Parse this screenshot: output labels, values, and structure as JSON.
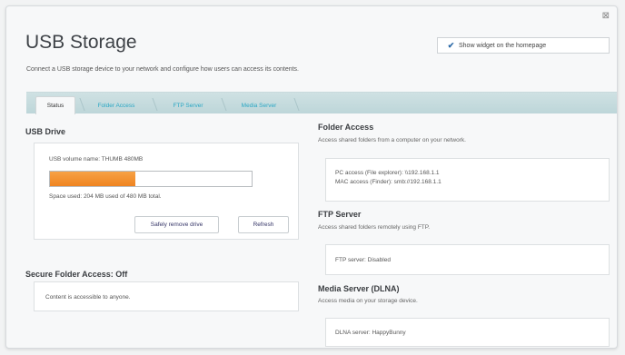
{
  "page": {
    "title": "USB Storage",
    "subtitle": "Connect a USB storage device to your network and configure how users can access its contents.",
    "show_widget_label": "Show widget on the homepage",
    "show_widget_checked": true
  },
  "tabs": [
    {
      "label": "Status",
      "active": true
    },
    {
      "label": "Folder Access",
      "active": false
    },
    {
      "label": "FTP Server",
      "active": false
    },
    {
      "label": "Media Server",
      "active": false
    }
  ],
  "usb_drive": {
    "heading": "USB Drive",
    "volume_name": "USB volume name: THUMB 480MB",
    "space_used_text": "Space used: 204 MB used of 480 MB total.",
    "used_fraction": 0.425,
    "safely_remove_label": "Safely remove drive",
    "refresh_label": "Refresh"
  },
  "secure_folder": {
    "heading": "Secure Folder Access: Off",
    "text": "Content is accessible to anyone."
  },
  "folder_access": {
    "heading": "Folder Access",
    "desc": "Access shared folders from a computer on your network.",
    "pc_access": "PC access (File explorer): \\\\192.168.1.1",
    "mac_access": "MAC access (Finder): smb://192.168.1.1"
  },
  "ftp_server": {
    "heading": "FTP Server",
    "desc": "Access shared folders remotely using FTP.",
    "status": "FTP server: Disabled"
  },
  "media_server": {
    "heading": "Media Server (DLNA)",
    "desc": "Access media on your storage device.",
    "status": "DLNA server: HappyBunny"
  },
  "colors": {
    "progress": "#ef8320",
    "tab_link": "#2aa7c4"
  },
  "icons": {
    "close": "close-icon",
    "check": "checkmark-icon"
  }
}
